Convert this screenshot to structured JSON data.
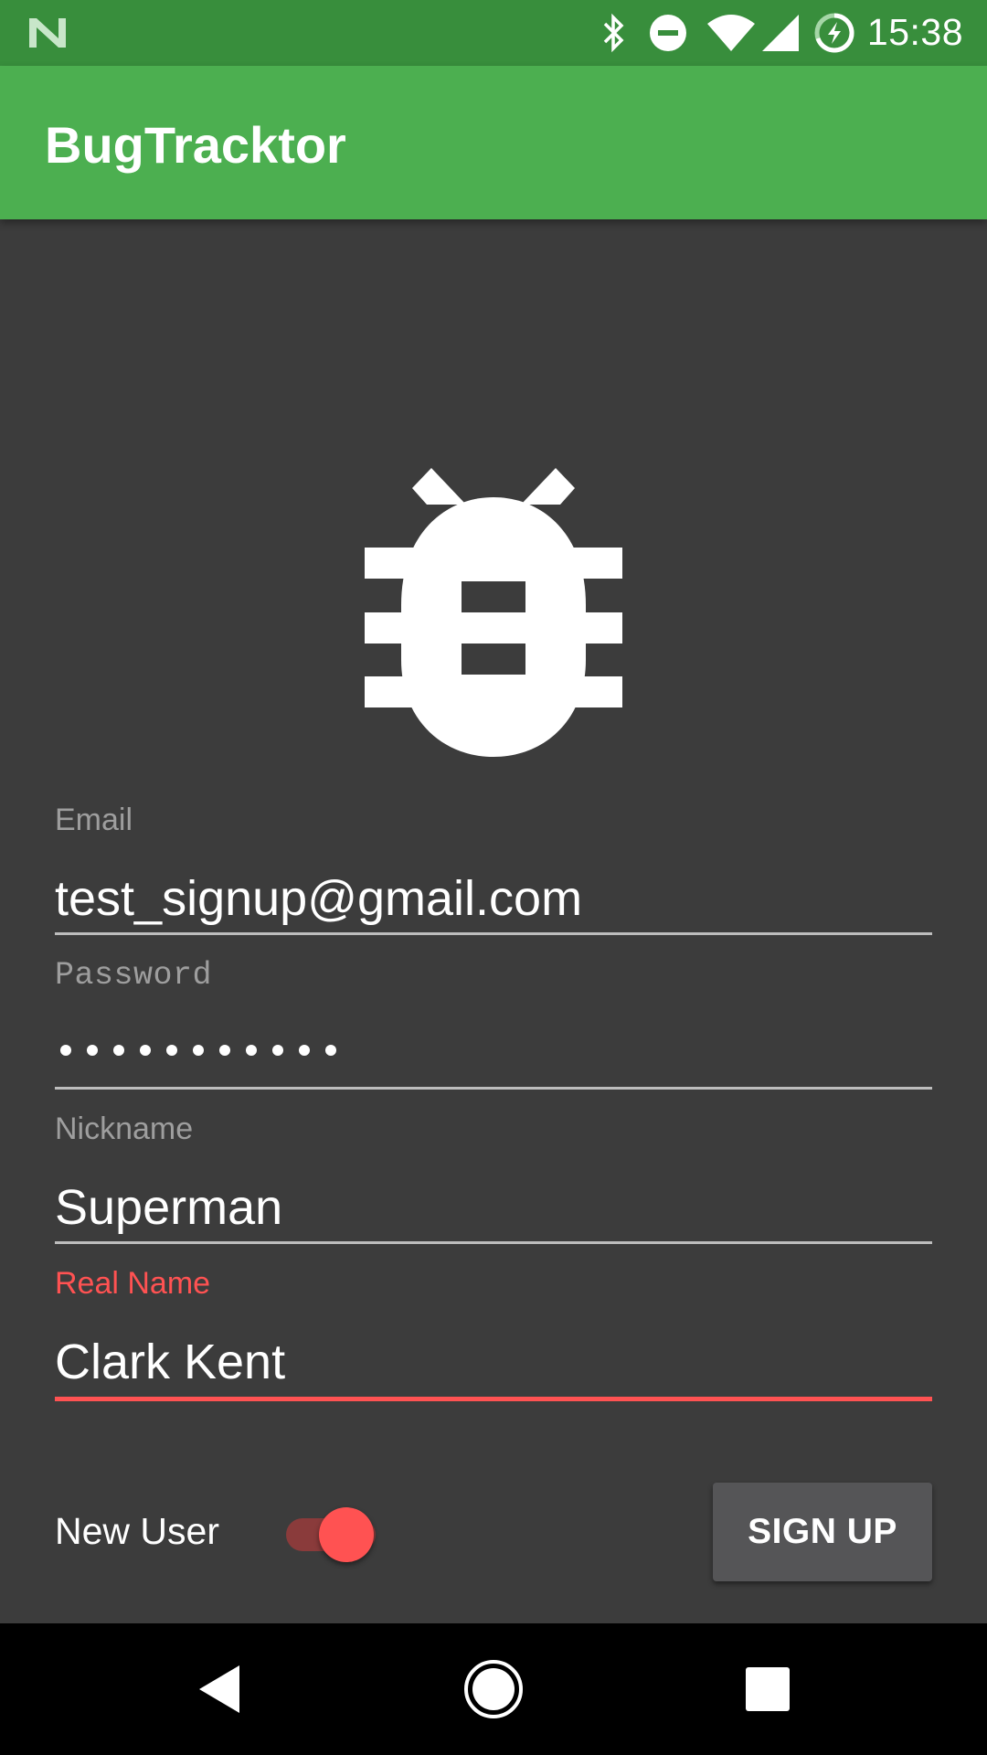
{
  "status_bar": {
    "time": "15:38",
    "icons": [
      "n-logo-icon",
      "bluetooth-icon",
      "do-not-disturb-icon",
      "wifi-icon",
      "cell-signal-icon",
      "battery-charging-icon"
    ]
  },
  "app_bar": {
    "title": "BugTracktor"
  },
  "logo": {
    "icon": "bug-icon"
  },
  "form": {
    "email": {
      "label": "Email",
      "value": "test_signup@gmail.com"
    },
    "password": {
      "label": "Password",
      "value_masked": "•••••••••••",
      "length": 11
    },
    "nickname": {
      "label": "Nickname",
      "value": "Superman"
    },
    "real_name": {
      "label": "Real Name",
      "value": "Clark Kent",
      "focused": true
    }
  },
  "new_user_toggle": {
    "label": "New User",
    "checked": true
  },
  "signup_button": {
    "label": "SIGN UP"
  },
  "colors": {
    "status_bar": "#388e3c",
    "app_bar": "#4caf50",
    "background": "#3c3c3c",
    "accent": "#ff5252",
    "button": "#555557"
  },
  "nav_bar": {
    "buttons": [
      "back-icon",
      "home-icon",
      "recents-icon"
    ]
  }
}
